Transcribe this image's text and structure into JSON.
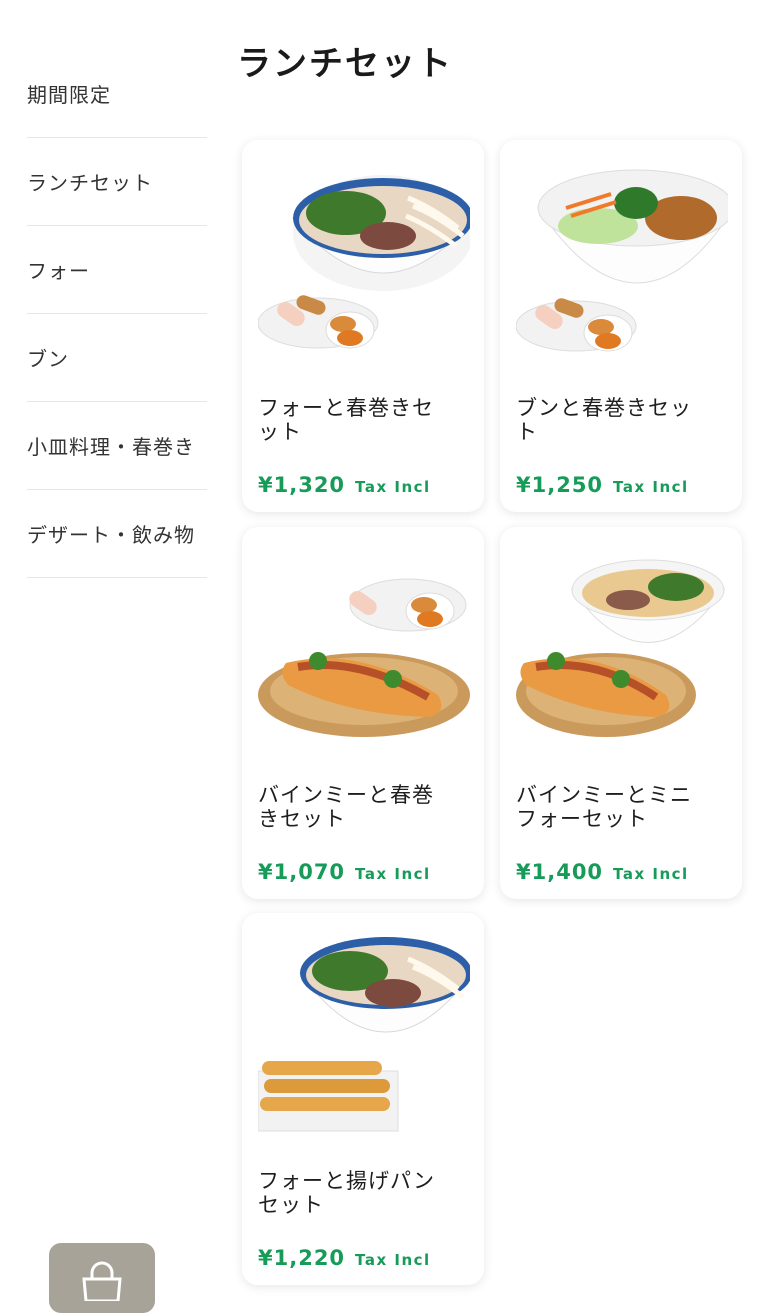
{
  "page": {
    "title": "ランチセット"
  },
  "categories": [
    {
      "label": "期間限定"
    },
    {
      "label": "ランチセット"
    },
    {
      "label": "フォー"
    },
    {
      "label": "ブン"
    },
    {
      "label": "小皿料理・春巻き"
    },
    {
      "label": "デザート・飲み物"
    }
  ],
  "products": [
    {
      "name": "フォーと春巻きセット",
      "price": "¥1,320",
      "tax": "Tax Incl"
    },
    {
      "name": "ブンと春巻きセット",
      "price": "¥1,250",
      "tax": "Tax Incl"
    },
    {
      "name": "バインミーと春巻きセット",
      "price": "¥1,070",
      "tax": "Tax Incl"
    },
    {
      "name": "バインミーとミニフォーセット",
      "price": "¥1,400",
      "tax": "Tax Incl"
    },
    {
      "name": "フォーと揚げパンセット",
      "price": "¥1,220",
      "tax": "Tax Incl"
    }
  ],
  "colors": {
    "price_green": "#179b58",
    "cart_bg": "#a7a398"
  },
  "icons": {
    "cart": "shopping-bag-icon"
  }
}
